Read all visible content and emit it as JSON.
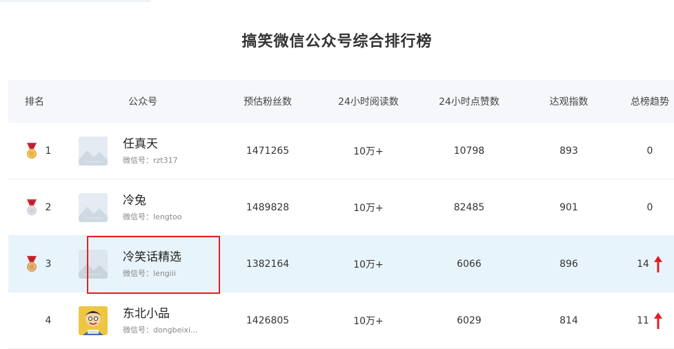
{
  "page_title": "搞笑微信公众号综合排行榜",
  "headers": {
    "rank": "排名",
    "account": "公众号",
    "fans": "预估粉丝数",
    "reads": "24小时阅读数",
    "likes": "24小时点赞数",
    "index": "达观指数",
    "trend": "总榜趋势"
  },
  "wechat_label": "微信号：",
  "rows": [
    {
      "rank": "1",
      "name": "任真天",
      "wechat_id": "rzt317",
      "fans": "1471265",
      "reads": "10万+",
      "likes": "10798",
      "index": "893",
      "trend": "0",
      "medal_color": "#e8b33d"
    },
    {
      "rank": "2",
      "name": "冷兔",
      "wechat_id": "lengtoo",
      "fans": "1489828",
      "reads": "10万+",
      "likes": "82485",
      "index": "901",
      "trend": "0",
      "medal_color": "#cfd3d8"
    },
    {
      "rank": "3",
      "name": "冷笑话精选",
      "wechat_id": "lengiii",
      "fans": "1382164",
      "reads": "10万+",
      "likes": "6066",
      "index": "896",
      "trend": "14",
      "medal_color": "#d9a15a"
    },
    {
      "rank": "4",
      "name": "东北小品",
      "wechat_id": "dongbeixi...",
      "fans": "1426805",
      "reads": "10万+",
      "likes": "6029",
      "index": "814",
      "trend": "11"
    }
  ],
  "colors": {
    "ribbon": "#d8303c",
    "trend_up": "#e02020",
    "highlight_row": "#e8f4fb",
    "header_bg": "#f5f7fa"
  },
  "icons": {
    "medal": "medal-icon",
    "avatar_placeholder": "image-placeholder-icon",
    "trend_up": "arrow-up-icon"
  }
}
